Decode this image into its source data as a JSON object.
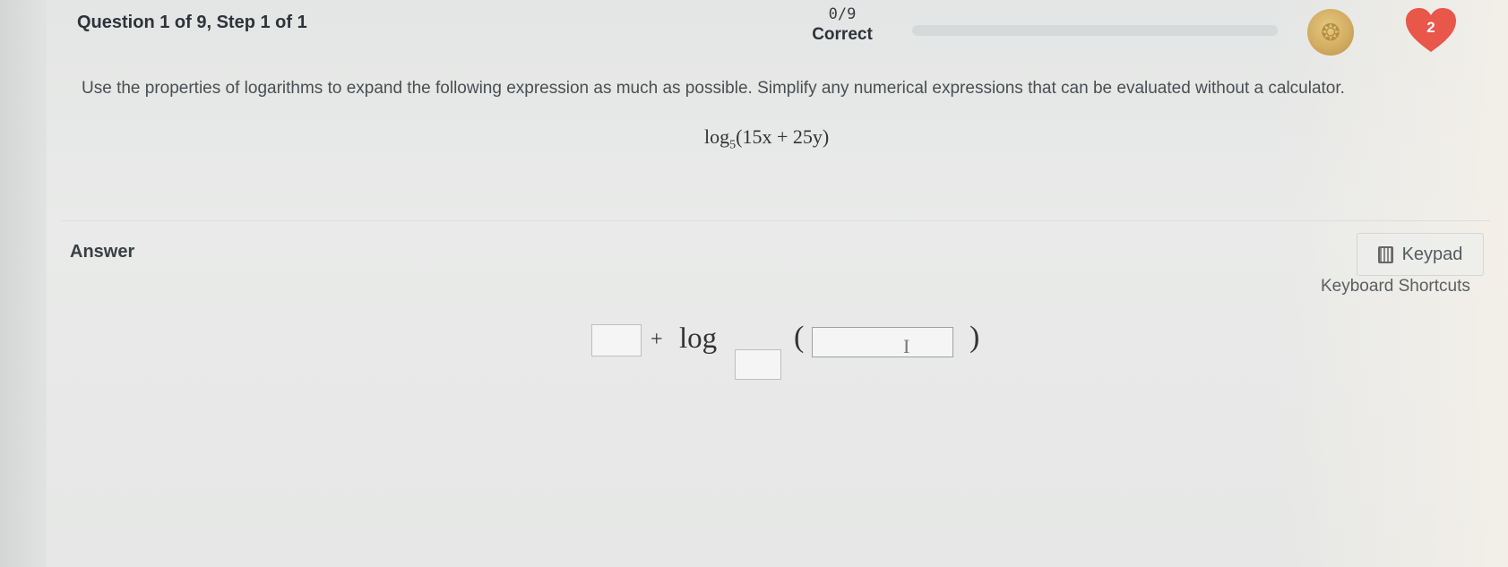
{
  "header": {
    "question_title": "Question 1 of 9, Step 1 of 1",
    "score": "0/9",
    "score_label": "Correct",
    "progress_fraction": 0,
    "hearts_count": "2",
    "colors": {
      "heart": "#e8574a",
      "coin": "#d2ad62",
      "progress_track": "#d6d9da"
    }
  },
  "question": {
    "prompt": "Use the properties of logarithms to expand the following expression as much as possible. Simplify any numerical expressions that can be evaluated without a calculator.",
    "expression": {
      "func": "log",
      "base": "5",
      "argument": "(15x + 25y)"
    }
  },
  "answer": {
    "label": "Answer",
    "keypad_label": "Keypad",
    "shortcuts_label": "Keyboard Shortcuts",
    "template": {
      "plus": "+",
      "func": "log",
      "lparen": "(",
      "rparen": ")"
    },
    "inputs": {
      "term_value": "",
      "base_value": "",
      "argument_value": ""
    },
    "icons": [
      "keypad-icon",
      "text-cursor-icon",
      "coin-icon",
      "heart-icon"
    ]
  }
}
